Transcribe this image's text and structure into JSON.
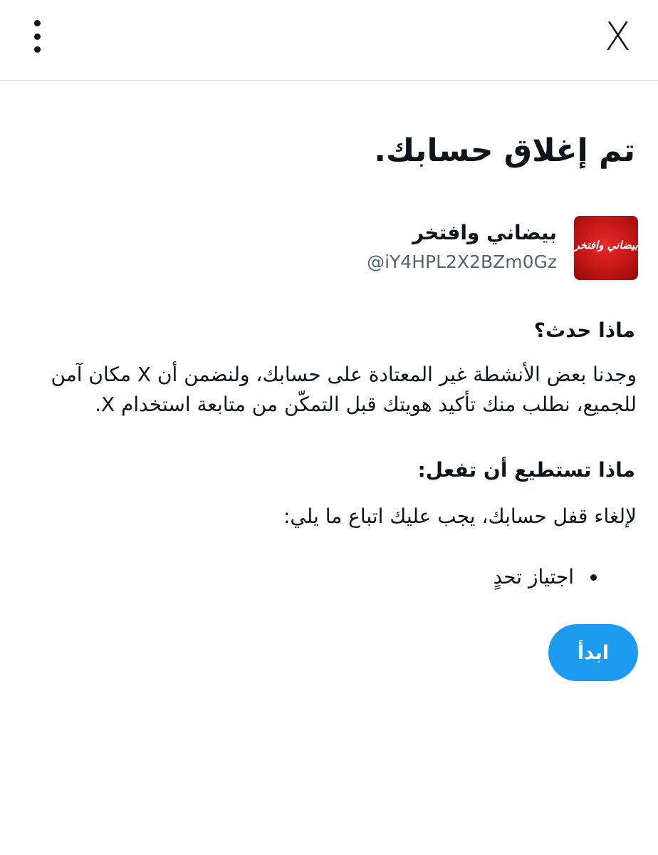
{
  "header": {
    "menu_icon": "more-vertical-icon",
    "logo_text": "X"
  },
  "title": "تم إغلاق حسابك.",
  "profile": {
    "display_name": "بيضاني وافتخر",
    "handle": "@iY4HPL2X2BZm0Gz",
    "avatar_text": "بيضاني وافتخر",
    "avatar_color": "#d11a1a"
  },
  "what_happened": {
    "heading": "ماذا حدث؟",
    "body": "وجدنا بعض الأنشطة غير المعتادة على حسابك، ولنضمن أن X مكان آمن للجميع، نطلب منك تأكيد هويتك قبل التمكّن من متابعة استخدام X."
  },
  "what_you_can_do": {
    "heading": "ماذا تستطيع أن تفعل:",
    "intro": "لإلغاء قفل حسابك، يجب عليك اتباع ما يلي:",
    "steps": [
      "اجتياز تحدٍ"
    ]
  },
  "start_button": {
    "label": "ابدأ",
    "color": "#1d9bf0"
  }
}
